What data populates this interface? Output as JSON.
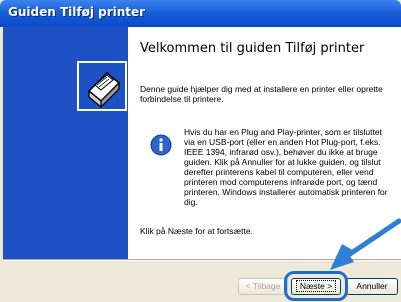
{
  "window": {
    "title": "Guiden Tilføj printer"
  },
  "wizard": {
    "heading": "Velkommen til guiden Tilføj printer",
    "intro": "Denne guide hjælper dig med at installere en printer eller oprette forbindelse til printere.",
    "info_text": "Hvis du har en Plug and Play-printer, som er tilsluttet via en USB-port (eller en anden Hot Plug-port, f.eks. IEEE 1394, infrarød osv.), behøver du ikke at bruge guiden. Klik på Annuller for at lukke guiden, og tilslut derefter printerens kabel til computeren, eller vend printeren mod computerens infrarøde port, og tænd printeren. Windows installerer automatisk printeren for dig.",
    "outro": "Klik på Næste for at fortsætte."
  },
  "buttons": {
    "back_label": "< Tilbage",
    "next_label": "Næste >",
    "cancel_label": "Annuller"
  },
  "icons": {
    "wizard": "printer-wizard-icon",
    "info": "info-icon",
    "pointer": "pointer-arrow"
  },
  "colors": {
    "titlebar": "#0b49c8",
    "sidepanel": "#1e51c3",
    "highlight": "#1f6fc4"
  }
}
